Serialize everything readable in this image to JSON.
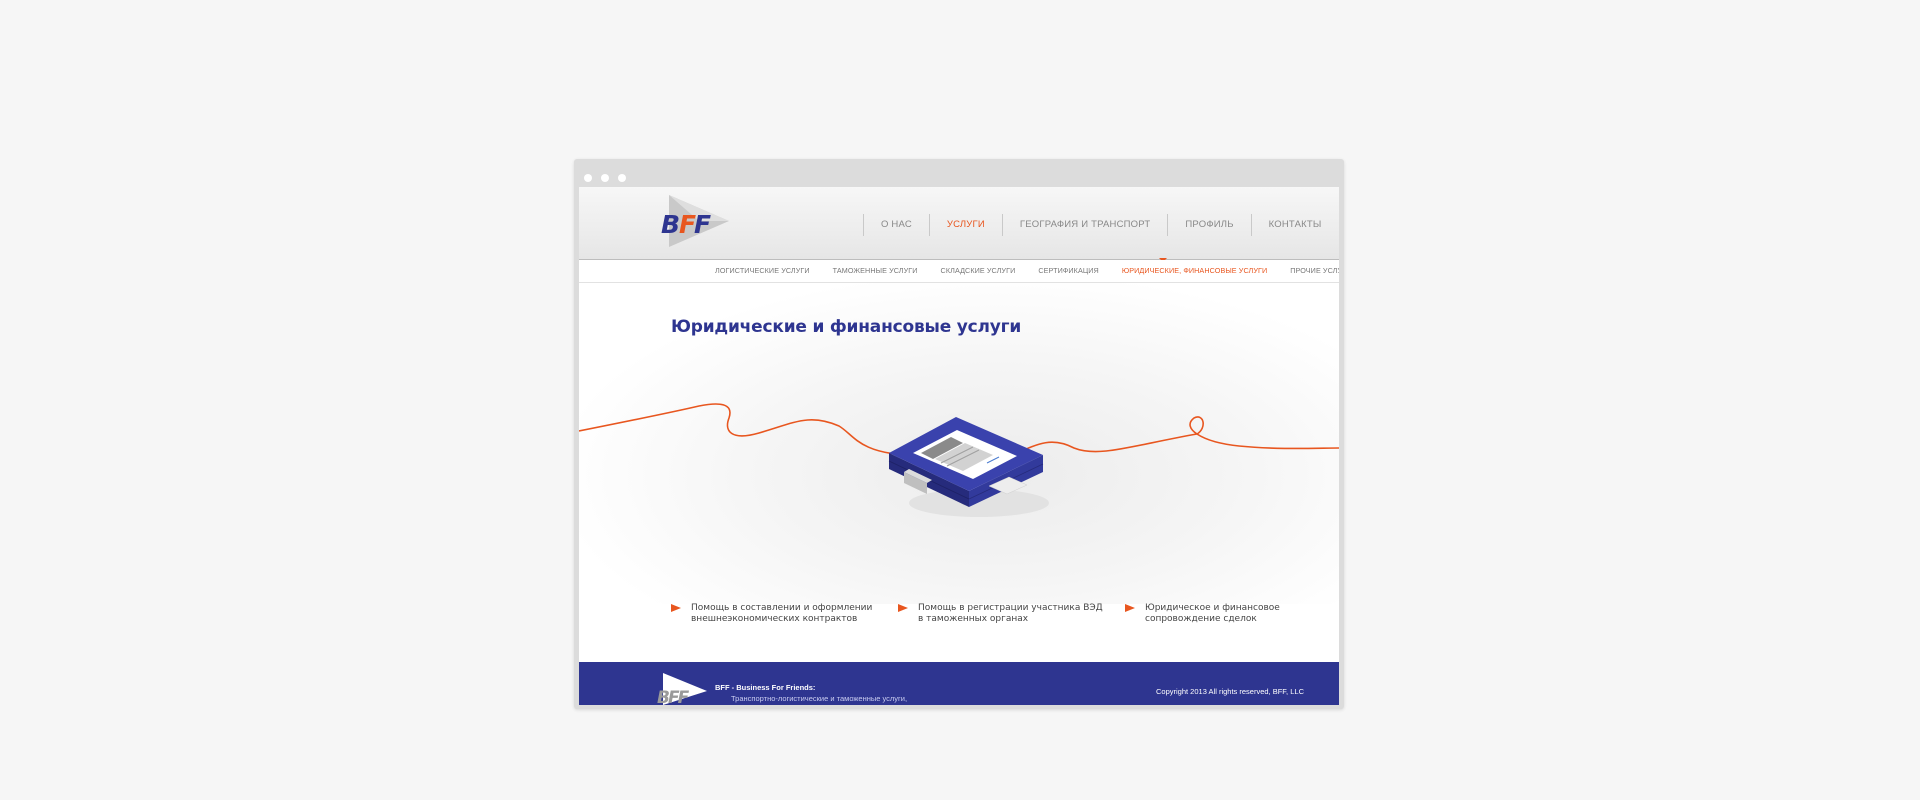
{
  "brand": {
    "logo_text": "BFF",
    "accent_color": "#e8561f",
    "primary_color": "#2e3590"
  },
  "nav": {
    "items": [
      {
        "label": "О НАС",
        "active": false
      },
      {
        "label": "УСЛУГИ",
        "active": true
      },
      {
        "label": "ГЕОГРАФИЯ И ТРАНСПОРТ",
        "active": false
      },
      {
        "label": "ПРОФИЛЬ",
        "active": false
      },
      {
        "label": "КОНТАКТЫ",
        "active": false
      }
    ]
  },
  "subnav": {
    "items": [
      {
        "label": "ЛОГИСТИЧЕСКИЕ УСЛУГИ",
        "active": false
      },
      {
        "label": "ТАМОЖЕННЫЕ УСЛУГИ",
        "active": false
      },
      {
        "label": "СКЛАДСКИЕ УСЛУГИ",
        "active": false
      },
      {
        "label": "СЕРТИФИКАЦИЯ",
        "active": false
      },
      {
        "label": "ЮРИДИЧЕСКИЕ, ФИНАНСОВЫЕ УСЛУГИ",
        "active": true
      },
      {
        "label": "ПРОЧИЕ УСЛУГИ",
        "active": false
      }
    ]
  },
  "main": {
    "title": "Юридические и финансовые услуги",
    "features": [
      {
        "line1": "Помощь в составлении и оформлении",
        "line2": "внешнеэкономических контрактов"
      },
      {
        "line1": "Помощь в регистрации участника ВЭД",
        "line2": "в таможенных органах"
      },
      {
        "line1": "Юридическое и финансовое",
        "line2": "сопровождение сделок"
      }
    ]
  },
  "footer": {
    "title": "BFF - Business For Friends:",
    "description": "Транспортно-логистические и таможенные услуги,",
    "copyright": "Copyright 2013 All rights reserved, BFF, LLC"
  },
  "icons": [
    "browser-dot-icon",
    "bff-logo",
    "feature-arrow-icon",
    "briefcase-illustration"
  ]
}
